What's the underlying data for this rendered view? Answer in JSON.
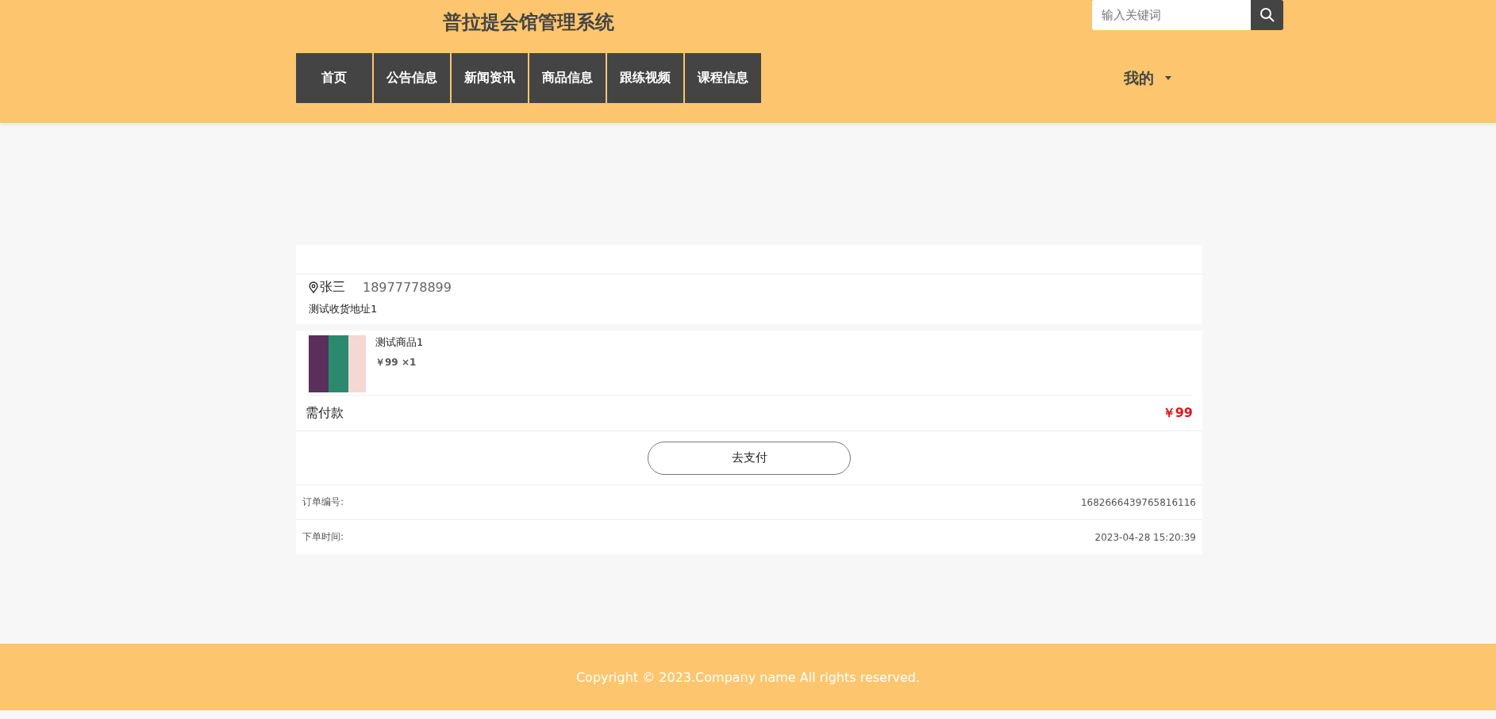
{
  "header": {
    "title": "普拉提会馆管理系统",
    "search": {
      "placeholder": "输入关键词"
    },
    "nav": [
      {
        "label": "首页"
      },
      {
        "label": "公告信息"
      },
      {
        "label": "新闻资讯"
      },
      {
        "label": "商品信息"
      },
      {
        "label": "跟练视频"
      },
      {
        "label": "课程信息"
      }
    ],
    "user_menu": "我的"
  },
  "order": {
    "address": {
      "name": "张三",
      "phone": "18977778899",
      "line": "测试收货地址1"
    },
    "items": [
      {
        "name": "测试商品1",
        "price": "￥99",
        "quantity": "×1"
      }
    ],
    "total_label": "需付款",
    "total": "￥99",
    "pay_button": "去支付",
    "details": [
      {
        "label": "订单编号:",
        "value": "1682666439765816116"
      },
      {
        "label": "下单时间:",
        "value": "2023-04-28 15:20:39"
      }
    ]
  },
  "footer": {
    "copyright": "Copyright © 2023.Company name All rights reserved."
  }
}
